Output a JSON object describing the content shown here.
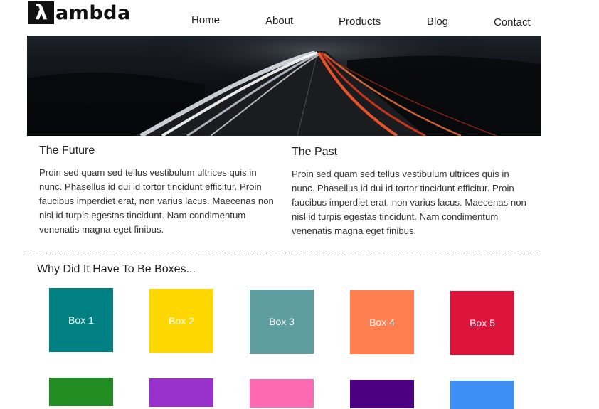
{
  "brand": {
    "logo_mark": "λ",
    "logo_text": "ambda"
  },
  "nav": {
    "items": [
      {
        "label": "Home"
      },
      {
        "label": "About"
      },
      {
        "label": "Products"
      },
      {
        "label": "Blog"
      },
      {
        "label": "Contact"
      }
    ]
  },
  "hero": {
    "image": "highway-light-trails-night"
  },
  "columns": [
    {
      "title": "The Future",
      "body": "Proin sed quam sed tellus vestibulum ultrices quis in nunc. Phasellus id dui id tortor tincidunt efficitur. Proin faucibus imperdiet erat, non varius lacus. Maecenas non nisl id turpis egestas tincidunt. Nam condimentum venenatis magna eget finibus."
    },
    {
      "title": "The Past",
      "body": "Proin sed quam sed tellus vestibulum ultrices quis in nunc. Phasellus id dui id tortor tincidunt efficitur. Proin faucibus imperdiet erat, non varius lacus. Maecenas non nisl id turpis egestas tincidunt. Nam condimentum venenatis magna eget finibus."
    }
  ],
  "boxes_section": {
    "title": "Why Did It Have To Be Boxes...",
    "boxes": [
      {
        "label": "Box 1",
        "color": "#008080"
      },
      {
        "label": "Box 2",
        "color": "#FFD700"
      },
      {
        "label": "Box 3",
        "color": "#5F9EA0"
      },
      {
        "label": "Box 4",
        "color": "#FF7F50"
      },
      {
        "label": "Box 5",
        "color": "#DC143C"
      },
      {
        "label": "",
        "color": "#228B22"
      },
      {
        "label": "",
        "color": "#9932CC"
      },
      {
        "label": "",
        "color": "#FF69B4"
      },
      {
        "label": "",
        "color": "#4B0082"
      },
      {
        "label": "",
        "color": "#3D8EF5"
      }
    ]
  }
}
